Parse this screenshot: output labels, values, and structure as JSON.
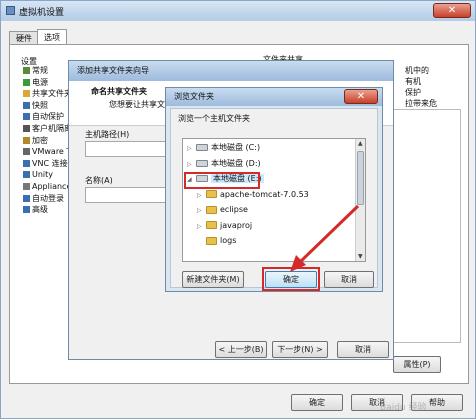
{
  "vm_settings": {
    "title": "虚拟机设置",
    "tabs": [
      "硬件",
      "选项"
    ],
    "settings_header": "设置",
    "items": [
      {
        "label": "常规",
        "icon": "general-icon",
        "color": "#5a8a3a"
      },
      {
        "label": "电源",
        "icon": "power-icon",
        "color": "#3c9a3c"
      },
      {
        "label": "共享文件夹",
        "icon": "shared-folder-icon",
        "color": "#d9a83a"
      },
      {
        "label": "快照",
        "icon": "snapshot-icon",
        "color": "#3a6fb0"
      },
      {
        "label": "自动保护",
        "icon": "autoprotect-icon",
        "color": "#3a6fb0"
      },
      {
        "label": "客户机隔离",
        "icon": "isolation-icon",
        "color": "#555555"
      },
      {
        "label": "加密",
        "icon": "lock-icon",
        "color": "#b08a2a"
      },
      {
        "label": "VMware T",
        "icon": "vmware-tools-icon",
        "color": "#666666"
      },
      {
        "label": "VNC 连接",
        "icon": "vnc-icon",
        "color": "#3a6fb0"
      },
      {
        "label": "Unity",
        "icon": "unity-icon",
        "color": "#3a6fb0"
      },
      {
        "label": "Appliance",
        "icon": "appliance-icon",
        "color": "#777777"
      },
      {
        "label": "自动登录",
        "icon": "autologin-icon",
        "color": "#3a6fb0"
      },
      {
        "label": "高级",
        "icon": "advanced-icon",
        "color": "#3a6fb0"
      }
    ],
    "shared_folder_header": "文件夹共享",
    "right_text": [
      "机中的",
      "有机",
      "保护",
      "拉带来危"
    ],
    "properties_button": "属性(P)",
    "ok_button": "确定",
    "cancel_button": "取消",
    "help_button": "帮助"
  },
  "wizard": {
    "title": "添加共享文件夹向导",
    "heading": "命名共享文件夹",
    "subheading": "您想要让共享文件",
    "host_path_label": "主机路径(H)",
    "name_label": "名称(A)",
    "back_button": "< 上一步(B)",
    "next_button": "下一步(N) >",
    "cancel_button": "取消"
  },
  "browse_dialog": {
    "title": "浏览文件夹",
    "instruction": "浏览一个主机文件夹",
    "tree": [
      {
        "label": "本地磁盘 (C:)",
        "type": "drive",
        "selected": false,
        "expandable": true
      },
      {
        "label": "本地磁盘 (D:)",
        "type": "drive",
        "selected": false,
        "expandable": true
      },
      {
        "label": "本地磁盘 (E:)",
        "type": "drive",
        "selected": true,
        "expandable": true
      },
      {
        "label": "apache-tomcat-7.0.53",
        "type": "folder",
        "selected": false,
        "expandable": true
      },
      {
        "label": "eclipse",
        "type": "folder",
        "selected": false,
        "expandable": true
      },
      {
        "label": "javaproj",
        "type": "folder",
        "selected": false,
        "expandable": true
      },
      {
        "label": "logs",
        "type": "folder",
        "selected": false,
        "expandable": false
      }
    ],
    "new_folder_button": "新建文件夹(M)",
    "ok_button": "确定",
    "cancel_button": "取消"
  },
  "annotation_color": "#d42a2a",
  "watermark": "Baidu 经验"
}
